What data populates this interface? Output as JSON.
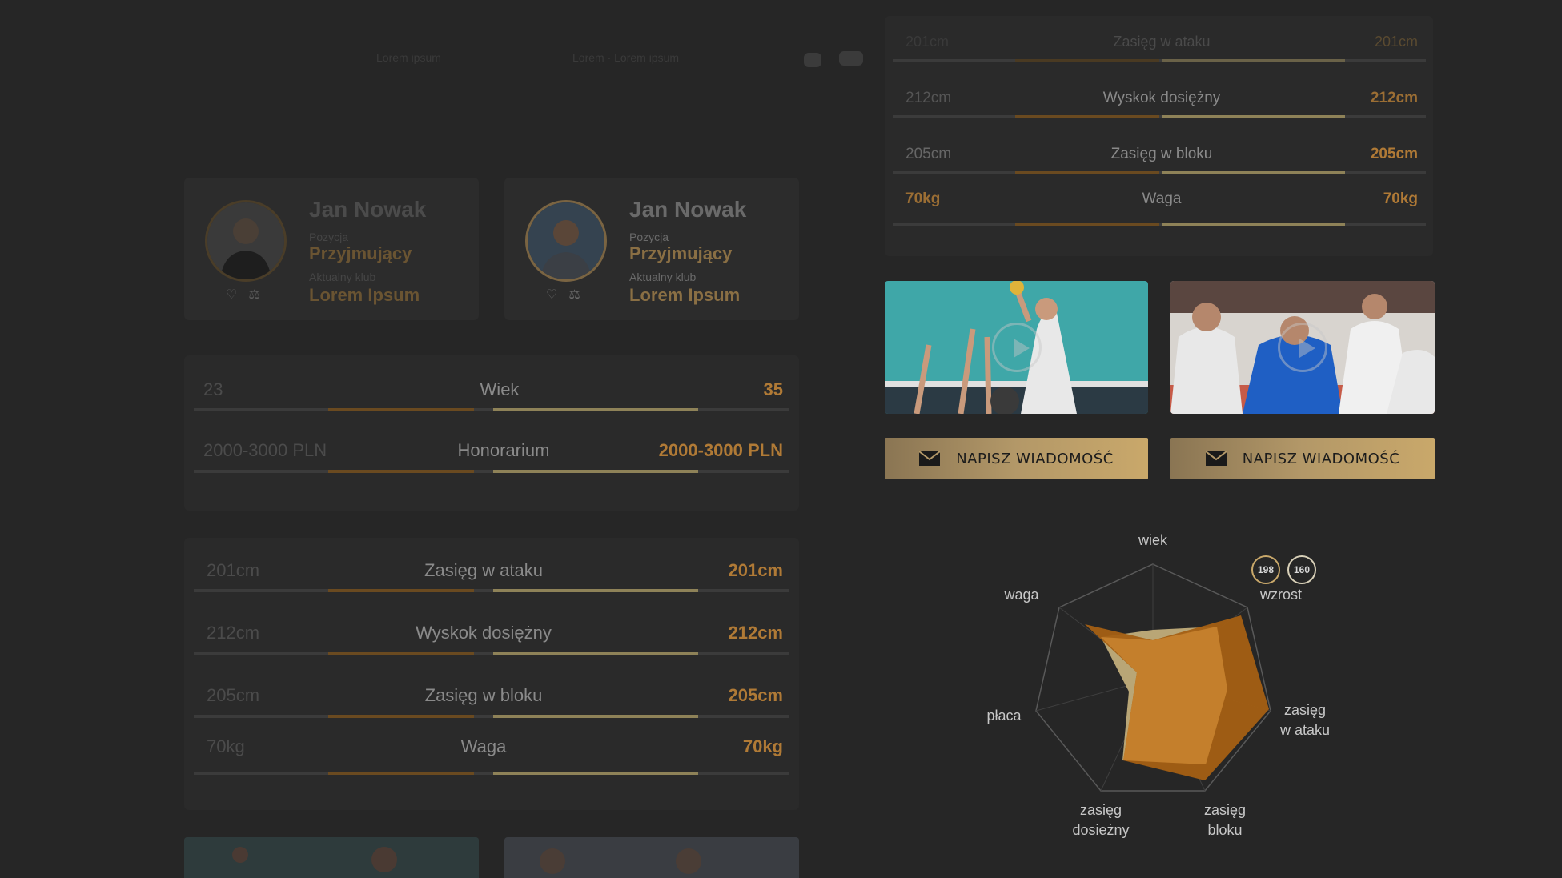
{
  "topbar": {
    "text_a": "Lorem ipsum",
    "text_b": "Lorem · Lorem ipsum"
  },
  "players": [
    {
      "name": "Jan Nowak",
      "position_label": "Pozycja",
      "position": "Przyjmujący",
      "club_label": "Aktualny klub",
      "club": "Lorem Ipsum"
    },
    {
      "name": "Jan Nowak",
      "position_label": "Pozycja",
      "position": "Przyjmujący",
      "club_label": "Aktualny klub",
      "club": "Lorem Ipsum"
    }
  ],
  "panel_age": {
    "rows": [
      {
        "left": "23",
        "label": "Wiek",
        "right": "35"
      },
      {
        "left": "2000-3000 PLN",
        "label": "Honorarium",
        "right": "2000-3000 PLN"
      }
    ]
  },
  "panel_reach": {
    "rows": [
      {
        "left": "201cm",
        "label": "Zasięg w ataku",
        "right": "201cm"
      },
      {
        "left": "212cm",
        "label": "Wyskok  dosiężny",
        "right": "212cm"
      },
      {
        "left": "205cm",
        "label": "Zasięg w bloku",
        "right": "205cm"
      },
      {
        "left": "70kg",
        "label": "Waga",
        "right": "70kg"
      }
    ]
  },
  "right_panel": {
    "rows": [
      {
        "left": "201cm",
        "label": "Zasięg w ataku",
        "right": "201cm"
      },
      {
        "left": "212cm",
        "label": "Wyskok  dosiężny",
        "right": "212cm"
      },
      {
        "left": "205cm",
        "label": "Zasięg w bloku",
        "right": "205cm"
      },
      {
        "left": "70kg",
        "label": "Waga",
        "right": "70kg"
      }
    ]
  },
  "message_buttons": [
    "NAPISZ WIADOMOŚĆ",
    "NAPISZ WIADOMOŚĆ"
  ],
  "radar": {
    "labels": {
      "wiek": "wiek",
      "wzrost": "wzrost",
      "zasieg_ataku_1": "zasięg",
      "zasieg_ataku_2": "w ataku",
      "zasieg_bloku_1": "zasięg",
      "zasieg_bloku_2": "bloku",
      "zasieg_dosiezny_1": "zasięg",
      "zasieg_dosiezny_2": "dosieżny",
      "placa": "płaca",
      "waga": "waga"
    },
    "badges": [
      "198",
      "160"
    ],
    "colors": {
      "series_a": "#a45f13",
      "series_b": "#b9a676",
      "overlap": "#c47f2c"
    }
  }
}
